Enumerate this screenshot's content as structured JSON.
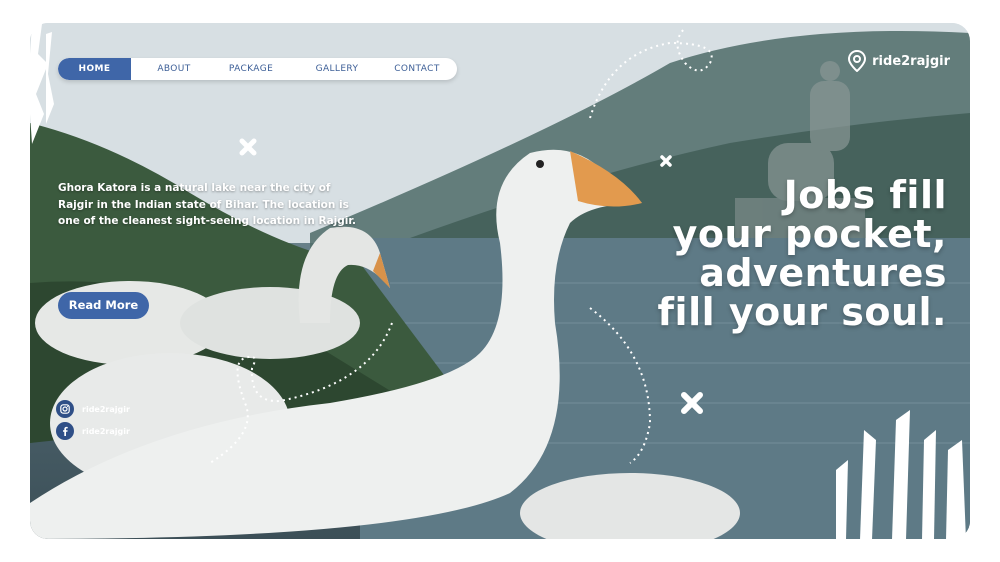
{
  "nav": {
    "items": [
      {
        "label": "HOME",
        "active": true
      },
      {
        "label": "ABOUT",
        "active": false
      },
      {
        "label": "PACKAGE",
        "active": false
      },
      {
        "label": "GALLERY",
        "active": false
      },
      {
        "label": "CONTACT",
        "active": false
      }
    ]
  },
  "brand": {
    "name": "ride2rajgir",
    "icon": "map-pin-icon"
  },
  "intro": {
    "text": "Ghora Katora is a natural lake near the city of Rajgir in the Indian state of Bihar. The location is one of the cleanest sight-seeing location in Rajgir.",
    "button_label": "Read More"
  },
  "headline": {
    "lines": [
      "Jobs fill",
      "your pocket,",
      "adventures",
      "fill your soul."
    ]
  },
  "social": {
    "instagram": {
      "handle": "ride2rajgir",
      "icon": "instagram-icon"
    },
    "facebook": {
      "handle": "ride2rajgir",
      "icon": "facebook-icon"
    }
  },
  "colors": {
    "accent": "#3f66a8",
    "text": "#ffffff",
    "nav_text": "#3d5f97"
  }
}
